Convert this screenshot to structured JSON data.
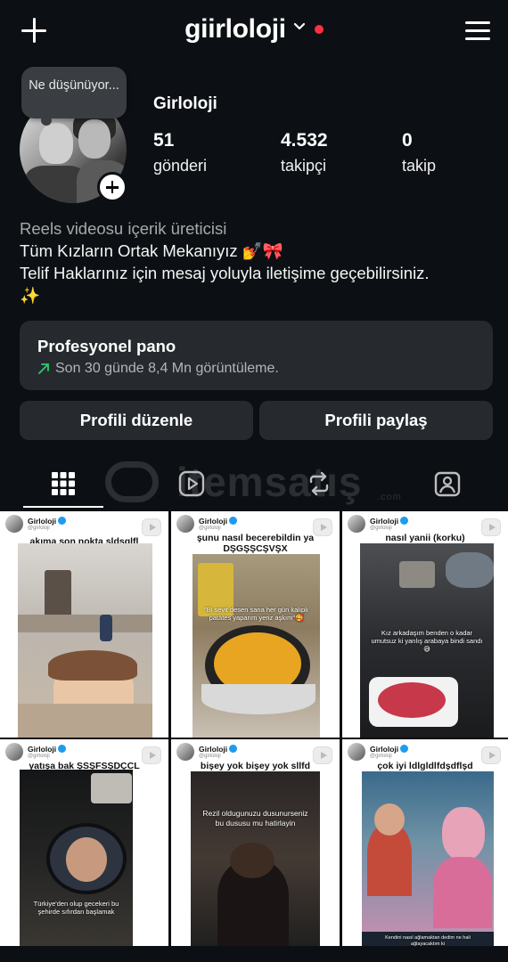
{
  "header": {
    "username": "giirloloji"
  },
  "note": {
    "text": "Ne düşünüyor..."
  },
  "profile": {
    "display_name": "Girloloji",
    "stats": [
      {
        "value": "51",
        "label": "gönderi"
      },
      {
        "value": "4.532",
        "label": "takipçi"
      },
      {
        "value": "0",
        "label": "takip"
      }
    ]
  },
  "bio": {
    "category": "Reels videosu içerik üreticisi",
    "line1": "Tüm Kızların Ortak Mekanıyız 💅🎀",
    "line2": "Telif Haklarınız için mesaj yoluyla iletişime geçebilirsiniz.",
    "line3": "✨"
  },
  "dashboard": {
    "title": "Profesyonel pano",
    "subtitle": "Son 30 günde 8,4 Mn görüntüleme."
  },
  "buttons": {
    "edit": "Profili düzenle",
    "share": "Profili paylaş"
  },
  "tabs": [
    "posts-grid",
    "reels",
    "reposts",
    "tagged"
  ],
  "watermark": {
    "text": "itemsatış",
    "suffix": ".com"
  },
  "posts": [
    {
      "name": "Girloloji",
      "handle": "@girloloji",
      "caption": "akıma son nokta sldşglfl",
      "overlay": ""
    },
    {
      "name": "Girloloji",
      "handle": "@girloloji",
      "caption": "şunu nasıl becerebildin ya DŞGŞŞCŞVŞX",
      "overlay": "\"Bi sevit desen sana her gün kalıplı patates yaparım yeriz aşkım\"🥰"
    },
    {
      "name": "Girloloji",
      "handle": "@girloloji",
      "caption": "nasıl yanii (korku)",
      "overlay": "Kız arkadaşım benden o kadar umutsuz ki yanlış arabaya bindi sandı 😅"
    },
    {
      "name": "Girloloji",
      "handle": "@girloloji",
      "caption": "yatışa bak ŞSŞFSŞDÇCL",
      "overlay": "Türkiye'den olup gecekeri bu şehirde sıfırdan başlamak"
    },
    {
      "name": "Girloloji",
      "handle": "@girloloji",
      "caption": "bişey yok bişey yok sllfd",
      "overlay": "Rezil oldugunuzu dusunurseniz bu dususu mu hatirlayin"
    },
    {
      "name": "Girloloji",
      "handle": "@girloloji",
      "caption": "çok iyi ldlgldlfdşdflşd",
      "overlay": "Kendini nasıl ağlamaktan dedim ne hali ağlayacaktım ki"
    }
  ]
}
